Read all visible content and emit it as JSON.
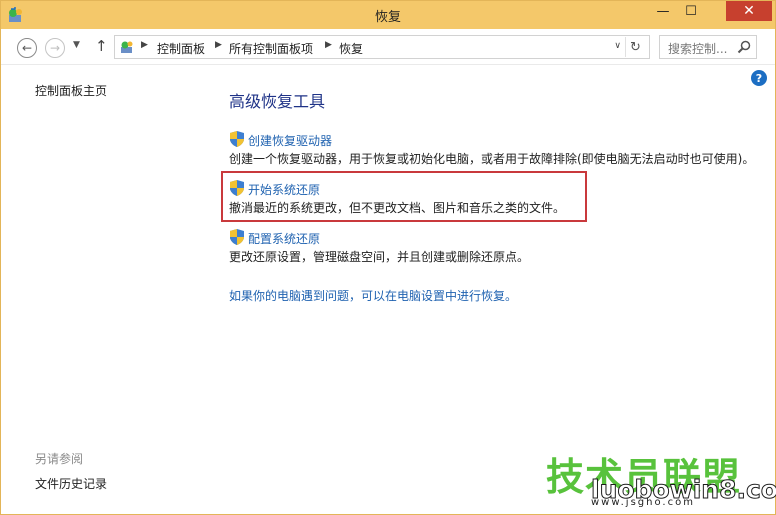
{
  "window": {
    "title": "恢复",
    "minimize_glyph": "—",
    "maximize_glyph": "☐",
    "close_glyph": "✕"
  },
  "nav": {
    "back_glyph": "←",
    "forward_glyph": "→",
    "dropdown_glyph": "▼",
    "up_glyph": "↑"
  },
  "address": {
    "crumbs": [
      "控制面板",
      "所有控制面板项",
      "恢复"
    ],
    "separator": "▶",
    "dropdown_glyph": "∨",
    "refresh_glyph": "↻"
  },
  "search": {
    "placeholder": "搜索控制..."
  },
  "help": {
    "glyph": "?"
  },
  "left": {
    "home": "控制面板主页",
    "see_also": "另请参阅",
    "history": "文件历史记录"
  },
  "main": {
    "title": "高级恢复工具",
    "tasks": [
      {
        "link": "创建恢复驱动器",
        "desc": "创建一个恢复驱动器，用于恢复或初始化电脑，或者用于故障排除(即使电脑无法启动时也可使用)。"
      },
      {
        "link": "开始系统还原",
        "desc": "撤消最近的系统更改，但不更改文档、图片和音乐之类的文件。"
      },
      {
        "link": "配置系统还原",
        "desc": "更改还原设置，管理磁盘空间，并且创建或删除还原点。"
      }
    ],
    "settings_link": "如果你的电脑遇到问题，可以在电脑设置中进行恢复。"
  },
  "watermark": {
    "cn": "技术员联盟",
    "en": "luobowin8.com",
    "small": "www.jsgho.com"
  },
  "colors": {
    "titlebar": "#f4c86a",
    "link": "#1f62b0",
    "heading": "#1e3287",
    "highlight_border": "#c9393c",
    "close_button": "#c7402e"
  }
}
